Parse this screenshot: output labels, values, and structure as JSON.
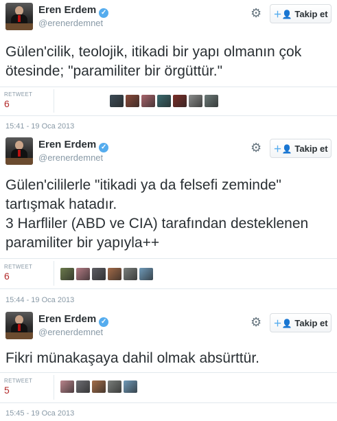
{
  "tweets": [
    {
      "name": "Eren Erdem",
      "handle": "@erenerdemnet",
      "follow_label": "Takip et",
      "text": "Gülen'cilik, teolojik, itikadi bir yapı olmanın çok ötesinde; \"paramiliter bir örgüttür.\"",
      "retweet_label": "RETWEET",
      "retweet_count": "6",
      "retweeter_colors": [
        "#3d4c57",
        "#8a4a3a",
        "#a8646b",
        "#3b6a6e",
        "#7a2e28",
        "#8b8d8c",
        "#6c7a78"
      ],
      "timestamp": "15:41 - 19 Oca 2013"
    },
    {
      "name": "Eren Erdem",
      "handle": "@erenerdemnet",
      "follow_label": "Takip et",
      "text": "Gülen'cililerle \"itikadi ya da felsefi zeminde\" tartışmak hatadır.\n3 Harfliler (ABD ve CIA) tarafından desteklenen paramiliter bir yapıyla++",
      "retweet_label": "RETWEET",
      "retweet_count": "6",
      "retweeter_colors": [
        "#6b7a4c",
        "#b27a83",
        "#5d5d63",
        "#a26a48",
        "#7a7f7c",
        "#6f9ab8"
      ],
      "timestamp": "15:44 - 19 Oca 2013"
    },
    {
      "name": "Eren Erdem",
      "handle": "@erenerdemnet",
      "follow_label": "Takip et",
      "text": "Fikri münakaşaya dahil olmak absürttür.",
      "retweet_label": "RETWEET",
      "retweet_count": "5",
      "retweeter_colors": [
        "#b9848c",
        "#6d6d72",
        "#a46e4a",
        "#7a7e7b",
        "#6f9ab8"
      ],
      "timestamp": "15:45 - 19 Oca 2013"
    }
  ],
  "colors": {
    "accent": "#55acee",
    "retweet_count": "#b22a2a",
    "muted": "#8899a6"
  }
}
